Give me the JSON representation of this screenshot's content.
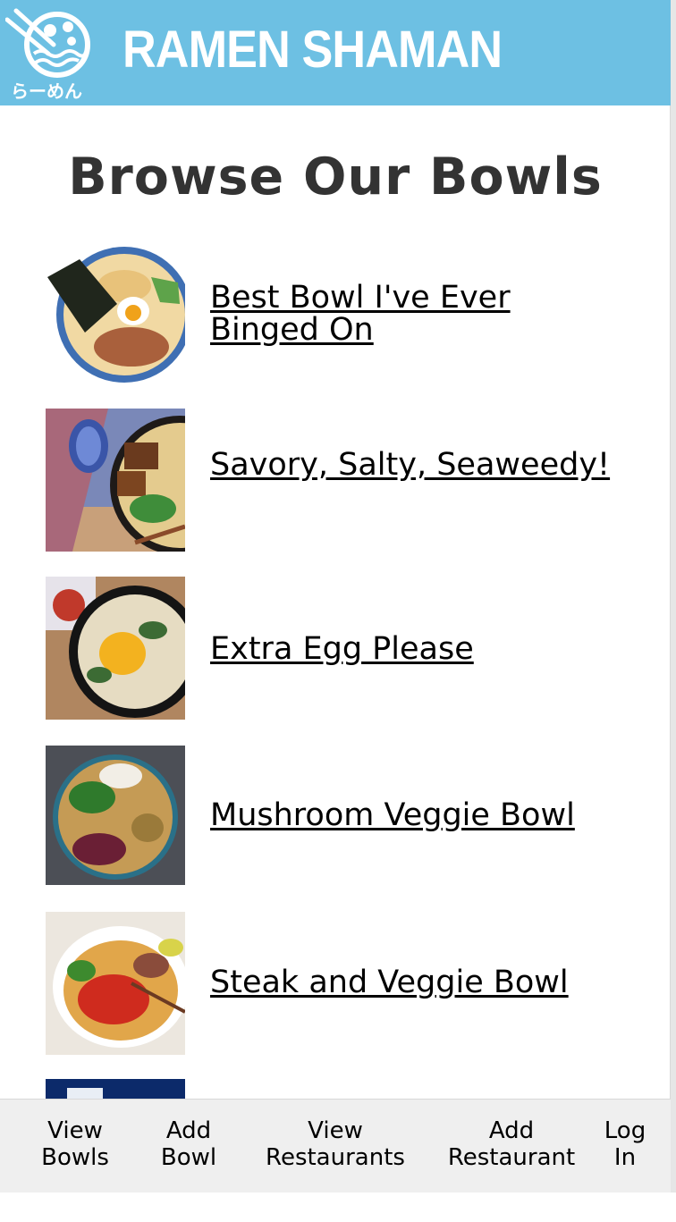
{
  "header": {
    "brand": "RAMEN SHAMAN",
    "logo_text": "らーめん",
    "bg_color": "#6dc0e3"
  },
  "page": {
    "title": "Browse Our Bowls"
  },
  "bowls": [
    {
      "title": "Best Bowl I've Ever Binged On"
    },
    {
      "title": "Savory, Salty, Seaweedy!"
    },
    {
      "title": "Extra Egg Please"
    },
    {
      "title": "Mushroom Veggie Bowl"
    },
    {
      "title": "Steak and Veggie Bowl"
    }
  ],
  "nav": {
    "view_bowls": "View Bowls",
    "add_bowl": "Add Bowl",
    "view_restaurants": "View Restaurants",
    "add_restaurant": "Add Restaurant",
    "log_in": "Log In"
  }
}
